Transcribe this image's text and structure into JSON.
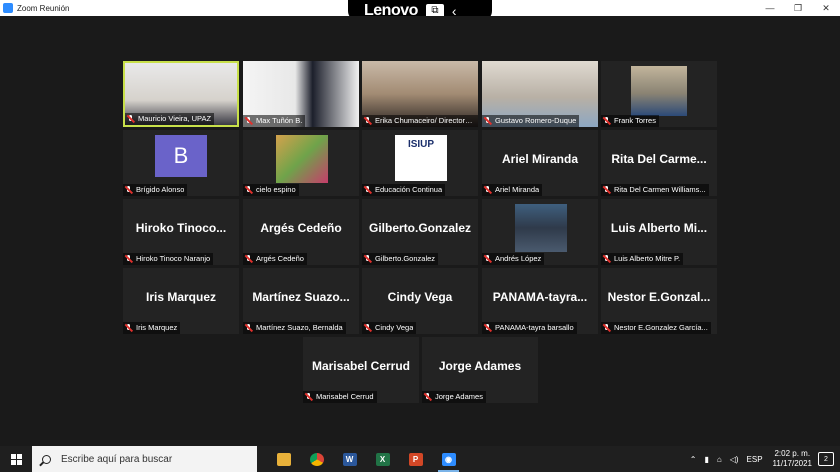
{
  "window": {
    "title": "Zoom Reunión",
    "minimize": "—",
    "restore": "❐",
    "close": "✕"
  },
  "overlay": {
    "brand": "Lenovo",
    "icon": "⧉",
    "chevron": "‹"
  },
  "tiles": [
    {
      "label": "Mauricio Vieira, UPAZ",
      "type": "video",
      "active": true
    },
    {
      "label": "Max Tuñón B.",
      "type": "video"
    },
    {
      "label": "Erika Chumaceiro/ Directora...",
      "type": "video"
    },
    {
      "label": "Gustavo Romero-Duque",
      "type": "video"
    },
    {
      "label": "Frank Torres",
      "type": "video"
    },
    {
      "label": "Brígido Alonso",
      "type": "avatar",
      "avatar_letter": "B"
    },
    {
      "label": "cielo espino",
      "type": "photo"
    },
    {
      "label": "Educación Continua",
      "type": "logo",
      "logo_text": "ISIUP"
    },
    {
      "label": "Ariel Miranda",
      "type": "name",
      "big": "Ariel Miranda"
    },
    {
      "label": "Rita Del Carmen Williams...",
      "type": "name",
      "big": "Rita Del Carme..."
    },
    {
      "label": "Hiroko Tinoco Naranjo",
      "type": "name",
      "big": "Hiroko Tinoco..."
    },
    {
      "label": "Argés Cedeño",
      "type": "name",
      "big": "Argés Cedeño"
    },
    {
      "label": "Gilberto.Gonzalez",
      "type": "name",
      "big": "Gilberto.Gonzalez"
    },
    {
      "label": "Andrés López",
      "type": "photo"
    },
    {
      "label": "Luis Alberto Mitre P.",
      "type": "name",
      "big": "Luis Alberto Mi..."
    },
    {
      "label": "Iris Marquez",
      "type": "name",
      "big": "Iris Marquez"
    },
    {
      "label": "Martínez Suazo, Bernalda",
      "type": "name",
      "big": "Martínez Suazo..."
    },
    {
      "label": "Cindy Vega",
      "type": "name",
      "big": "Cindy Vega"
    },
    {
      "label": "PANAMA-tayra barsallo",
      "type": "name",
      "big": "PANAMA-tayra..."
    },
    {
      "label": "Nestor E.Gonzalez García...",
      "type": "name",
      "big": "Nestor E.Gonzal..."
    },
    {
      "label": "Marisabel Cerrud",
      "type": "name",
      "big": "Marisabel Cerrud"
    },
    {
      "label": "Jorge Adames",
      "type": "name",
      "big": "Jorge Adames"
    }
  ],
  "taskbar": {
    "search_placeholder": "Escribe aquí para buscar",
    "apps": [
      {
        "name": "file-explorer-icon",
        "glyph": "",
        "color": "#e8b13a"
      },
      {
        "name": "chrome-icon",
        "glyph": "",
        "color": "#db4437"
      },
      {
        "name": "word-icon",
        "glyph": "W",
        "color": "#2b579a"
      },
      {
        "name": "excel-icon",
        "glyph": "X",
        "color": "#217346"
      },
      {
        "name": "powerpoint-icon",
        "glyph": "P",
        "color": "#d24726"
      },
      {
        "name": "zoom-icon",
        "glyph": "◉",
        "color": "#2d8cff",
        "active": true
      }
    ],
    "tray": {
      "chevron": "⌃",
      "language": "ESP",
      "time": "2:02 p. m.",
      "date": "11/17/2021",
      "notifications": "2"
    }
  }
}
